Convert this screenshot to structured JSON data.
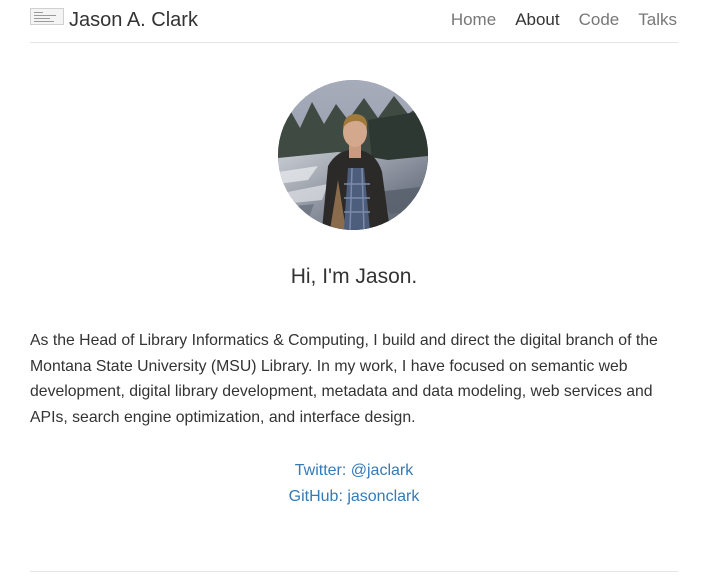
{
  "header": {
    "site_title": "Jason A. Clark",
    "nav": [
      {
        "label": "Home",
        "active": false
      },
      {
        "label": "About",
        "active": true
      },
      {
        "label": "Code",
        "active": false
      },
      {
        "label": "Talks",
        "active": false
      }
    ]
  },
  "main": {
    "greeting": "Hi, I'm Jason.",
    "bio": "As the Head of Library Informatics & Computing, I build and direct the digital branch of the Montana State University (MSU) Library. In my work, I have focused on semantic web development, digital library development, metadata and data modeling, web services and APIs, search engine optimization, and interface design.",
    "links": {
      "twitter": "Twitter: @jaclark",
      "github": "GitHub: jasonclark"
    }
  },
  "colors": {
    "text": "#333333",
    "nav_inactive": "#777777",
    "link": "#337ab7",
    "divider": "#e5e5e5"
  }
}
